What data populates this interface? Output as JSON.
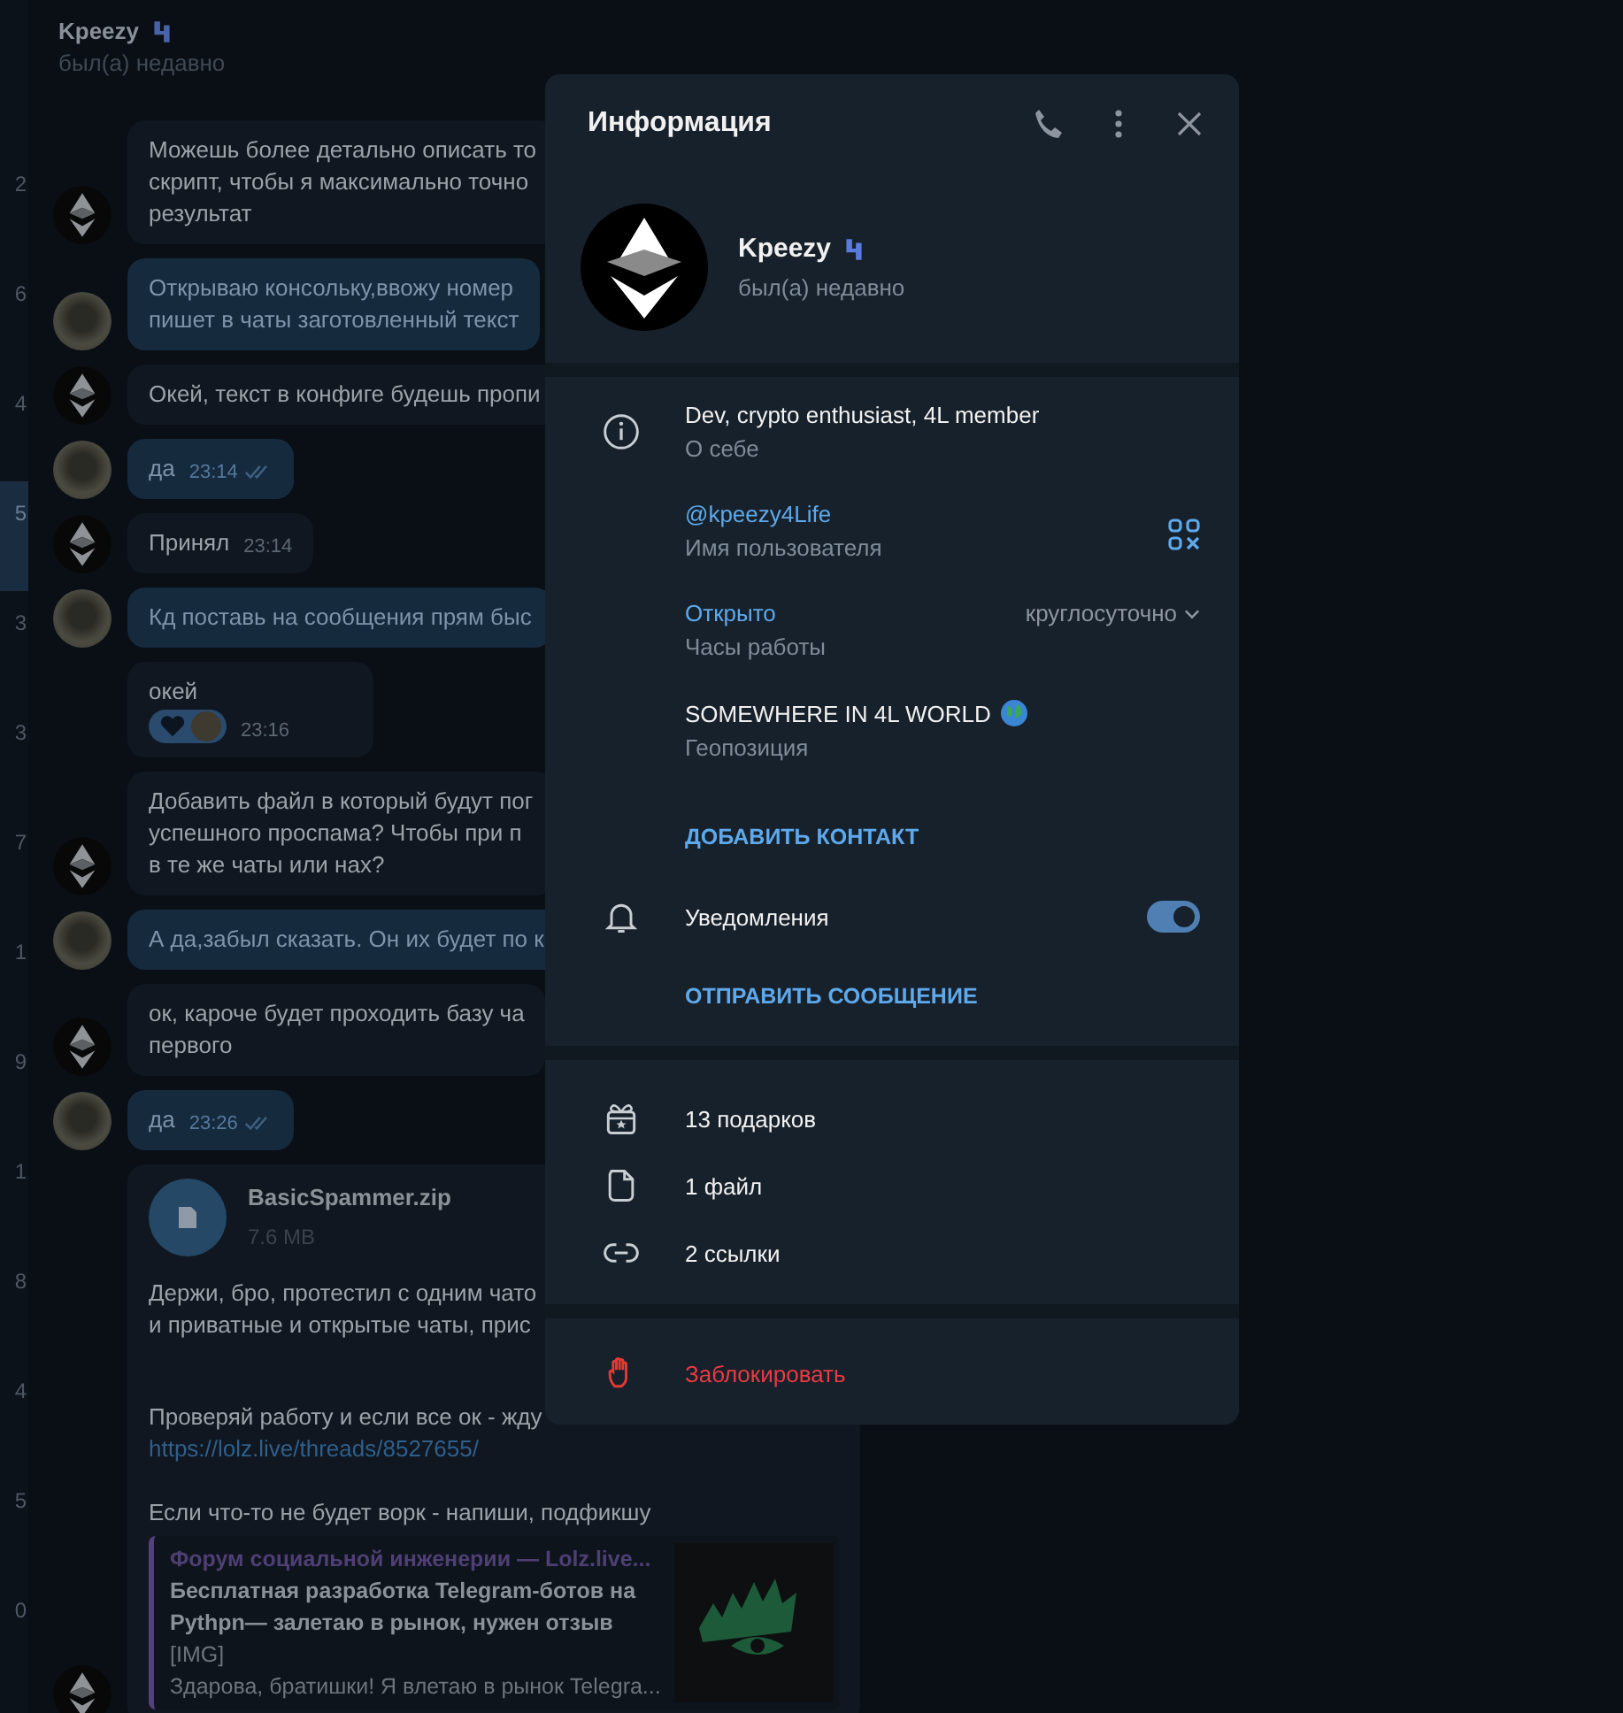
{
  "sidebar": {
    "items": [
      {
        "label": "2",
        "selected": false
      },
      {
        "label": "6",
        "selected": false
      },
      {
        "label": "4",
        "selected": false
      },
      {
        "label": "5",
        "selected": true
      },
      {
        "label": "3",
        "selected": false
      },
      {
        "label": "3",
        "selected": false
      },
      {
        "label": "7",
        "selected": false
      },
      {
        "label": "1",
        "selected": false
      },
      {
        "label": "9",
        "selected": false
      },
      {
        "label": "1",
        "selected": false
      },
      {
        "label": "8",
        "selected": false
      },
      {
        "label": "4",
        "selected": false
      },
      {
        "label": "5",
        "selected": false
      },
      {
        "label": "0",
        "selected": false
      }
    ]
  },
  "chat": {
    "header": {
      "name": "Kpeezy",
      "status": "был(а) недавно"
    },
    "messages": [
      {
        "kind": "in",
        "avatar": true,
        "lines": [
          "Можешь более детально описать то",
          "скрипт, чтобы я максимально точно",
          "результат"
        ]
      },
      {
        "kind": "out",
        "avatar": true,
        "lines": [
          "Открываю консольку,ввожу номер",
          "пишет в чаты заготовленный текст"
        ]
      },
      {
        "kind": "in",
        "avatar": true,
        "lines": [
          "Окей, текст в конфиге будешь пропи"
        ]
      },
      {
        "kind": "out",
        "avatar": true,
        "lines": [
          "да"
        ],
        "time": "23:14",
        "read": true
      },
      {
        "kind": "in",
        "avatar": true,
        "lines": [
          "Принял"
        ],
        "time": "23:14"
      },
      {
        "kind": "out",
        "avatar": true,
        "lines": [
          "Кд поставь на сообщения прям быс"
        ]
      },
      {
        "kind": "in",
        "avatar": false,
        "lines": [
          "окей"
        ],
        "time": "23:16",
        "reaction": true
      },
      {
        "kind": "in",
        "avatar": true,
        "lines": [
          "Добавить файл в который будут пог",
          "успешного проспама? Чтобы при п",
          "в те же чаты или нах?"
        ]
      },
      {
        "kind": "out",
        "avatar": true,
        "lines": [
          "А да,забыл сказать. Он их будет по к"
        ]
      },
      {
        "kind": "in",
        "avatar": true,
        "lines": [
          "ок, кароче будет проходить базу ча",
          "первого"
        ]
      },
      {
        "kind": "out",
        "avatar": true,
        "lines": [
          "да"
        ],
        "time": "23:26",
        "read": true
      },
      {
        "kind": "in",
        "avatar": true,
        "file": {
          "name": "BasicSpammer.zip",
          "size": "7.6 MB"
        },
        "paragraphs": [
          {
            "lines": [
              "Держи, бро, протестил с одним чато",
              "и приватные и открытые чаты, прис"
            ]
          },
          {
            "lines": [
              "Проверяй работу и если все ок - жду"
            ],
            "link": "https://lolz.live/threads/8527655/"
          },
          {
            "lines": [
              "Если что-то не будет ворк - напиши, подфикшу"
            ]
          }
        ],
        "preview": {
          "site": "Форум социальной инженерии —  Lolz.live...",
          "title": "Бесплатная разработка Telegram-ботов на Pythpn— залетаю в рынок, нужен отзыв",
          "lines": [
            "[IMG]",
            "Здарова, братишки! Я влетаю в рынок Telegra..."
          ]
        }
      }
    ]
  },
  "info_panel": {
    "title": "Информация",
    "profile": {
      "name": "Kpeezy",
      "status": "был(а) недавно"
    },
    "details": [
      {
        "kind": "bio",
        "value": "Dev, crypto enthusiast, 4L member",
        "label": "О себе"
      },
      {
        "kind": "username",
        "value": "@kpeezy4Life",
        "label": "Имя пользователя"
      },
      {
        "kind": "hours",
        "value": "Открыто",
        "extra": "круглосуточно",
        "label": "Часы работы"
      },
      {
        "kind": "location",
        "value": "SOMEWHERE IN 4L WORLD",
        "label": "Геопозиция"
      }
    ],
    "add_contact": "ДОБАВИТЬ КОНТАКТ",
    "notifications": {
      "label": "Уведомления",
      "on": true
    },
    "send_message": "ОТПРАВИТЬ СООБЩЕНИЕ",
    "media": [
      {
        "kind": "gifts",
        "label": "13 подарков"
      },
      {
        "kind": "files",
        "label": "1 файл"
      },
      {
        "kind": "links",
        "label": "2 ссылки"
      }
    ],
    "block": "Заблокировать"
  }
}
